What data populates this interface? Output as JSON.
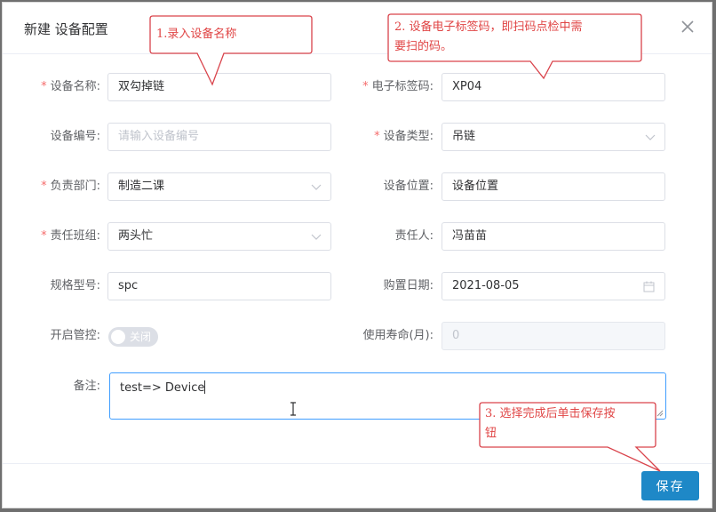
{
  "dialog": {
    "title": "新建 设备配置"
  },
  "form": {
    "device_name": {
      "label": "设备名称:",
      "value": "双勾掉链"
    },
    "rfid_code": {
      "label": "电子标签码:",
      "value": "XP04"
    },
    "device_no": {
      "label": "设备编号:",
      "placeholder": "请输入设备编号"
    },
    "device_type": {
      "label": "设备类型:",
      "value": "吊链"
    },
    "department": {
      "label": "负责部门:",
      "value": "制造二课"
    },
    "location": {
      "label": "设备位置:",
      "value": "设备位置"
    },
    "team": {
      "label": "责任班组:",
      "value": "两头忙"
    },
    "owner": {
      "label": "责任人:",
      "value": "冯苗苗"
    },
    "spec": {
      "label": "规格型号:",
      "value": "spc"
    },
    "purchase_date": {
      "label": "购置日期:",
      "value": "2021-08-05"
    },
    "control": {
      "label": "开启管控:",
      "state_text": "关闭"
    },
    "lifespan": {
      "label": "使用寿命(月):",
      "value": "0"
    },
    "remark": {
      "label": "备注:",
      "value": "test=> Device"
    },
    "required_mark": "*"
  },
  "footer": {
    "save_label": "保存"
  },
  "callouts": {
    "c1": "1.录入设备名称",
    "c2_line1": "2. 设备电子标签码，即扫码点检中需",
    "c2_line2": "要扫的码。",
    "c3_line1": "3. 选择完成后单击保存按",
    "c3_line2": "钮"
  },
  "colors": {
    "primary": "#1e88c7",
    "required": "#f56c6c",
    "focus_border": "#409eff",
    "callout_stroke": "#d9434b"
  }
}
